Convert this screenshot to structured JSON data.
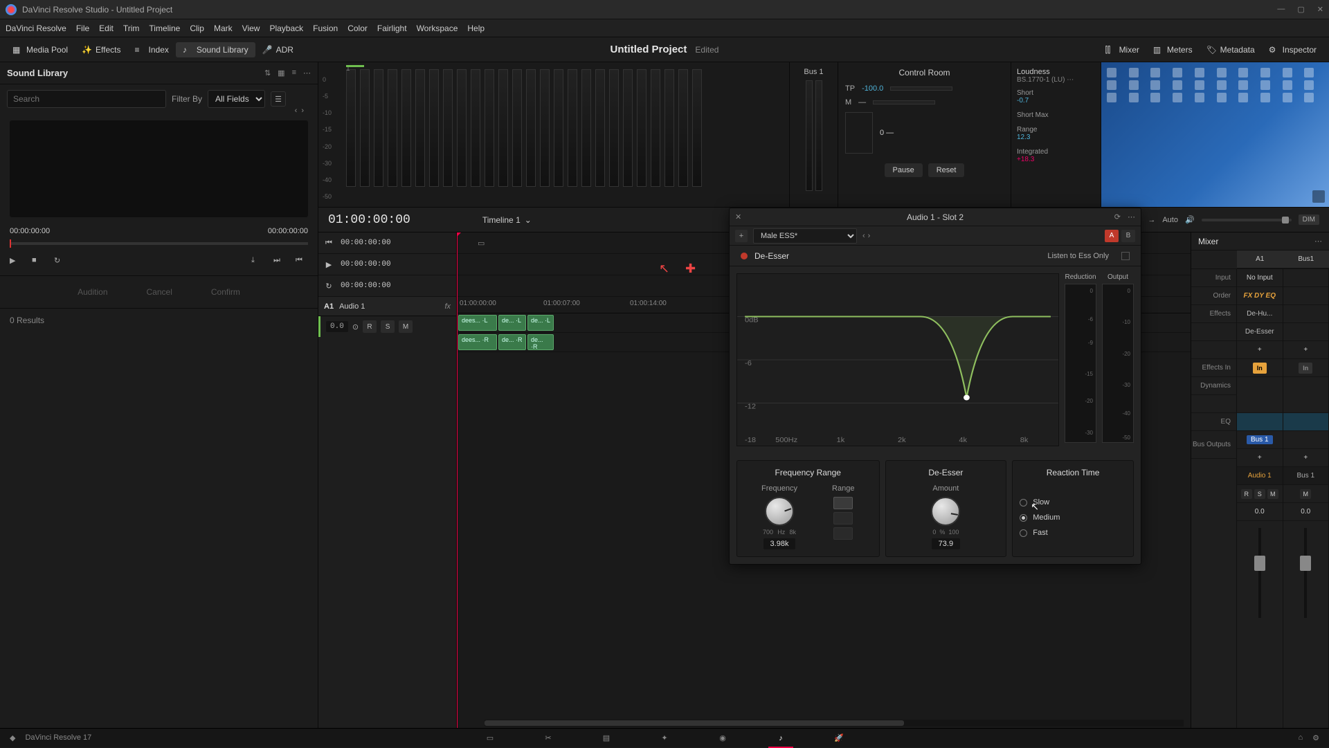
{
  "titlebar": {
    "title": "DaVinci Resolve Studio - Untitled Project"
  },
  "menu": [
    "DaVinci Resolve",
    "File",
    "Edit",
    "Trim",
    "Timeline",
    "Clip",
    "Mark",
    "View",
    "Playback",
    "Fusion",
    "Color",
    "Fairlight",
    "Workspace",
    "Help"
  ],
  "toolbar": {
    "media_pool": "Media Pool",
    "effects": "Effects",
    "index": "Index",
    "sound_library": "Sound Library",
    "adr": "ADR",
    "project": "Untitled Project",
    "status": "Edited",
    "mixer": "Mixer",
    "meters": "Meters",
    "metadata": "Metadata",
    "inspector": "Inspector"
  },
  "soundlib": {
    "title": "Sound Library",
    "search_placeholder": "Search",
    "filter_label": "Filter By",
    "filter_value": "All Fields",
    "tc_left": "00:00:00:00",
    "tc_right": "00:00:00:00",
    "audition": "Audition",
    "cancel": "Cancel",
    "confirm": "Confirm",
    "results": "0 Results"
  },
  "meters": {
    "scale": [
      "0",
      "-5",
      "-10",
      "-15",
      "-20",
      "-30",
      "-40",
      "-50"
    ],
    "bus": "Bus 1",
    "ctrl": {
      "title": "Control Room",
      "tp": "TP",
      "tp_val": "-100.0",
      "m": "M",
      "m_val": "—",
      "pause": "Pause",
      "reset": "Reset"
    },
    "loud": {
      "title": "Loudness",
      "std": "BS.1770-1 (LU)",
      "short": "Short",
      "short_v": "-0.7",
      "shortmax": "Short Max",
      "shortmax_v": "",
      "range": "Range",
      "range_v": "12.3",
      "integ": "Integrated",
      "integ_v": "+18.3"
    }
  },
  "tlheader": {
    "tc": "01:00:00:00",
    "name": "Timeline 1",
    "auto": "Auto",
    "dim": "DIM"
  },
  "transport_rows": {
    "tc1": "00:00:00:00",
    "tc2": "00:00:00:00",
    "tc3": "00:00:00:00"
  },
  "track": {
    "a1": "A1",
    "name": "Audio 1",
    "fx": "fx",
    "vol": "0.0",
    "r": "R",
    "s": "S",
    "m": "M"
  },
  "ruler": {
    "t0": "01:00:00:00",
    "t1": "01:00:07:00",
    "t2": "01:00:14:00"
  },
  "clips": {
    "c1": "dees... ·L",
    "c2": "de... ·L",
    "c3": "de... ·L",
    "c4": "dees... ·R",
    "c5": "de... ·R",
    "c6": "de... ·R"
  },
  "fx": {
    "title": "Audio 1 - Slot 2",
    "preset": "Male ESS*",
    "ab_a": "A",
    "ab_b": "B",
    "name": "De-Esser",
    "ess_label": "Listen to Ess Only",
    "reduction": "Reduction",
    "output": "Output",
    "graph_xticks": [
      "500Hz",
      "1k",
      "2k",
      "4k",
      "8k"
    ],
    "graph_yticks": [
      "0dB",
      "-6",
      "-12",
      "-18"
    ],
    "red_ticks": [
      "0",
      "-6",
      "-9",
      "-15",
      "-20",
      "-30"
    ],
    "out_ticks": [
      "0",
      "-10",
      "-20",
      "-30",
      "-40",
      "-50"
    ],
    "sec_freq": "Frequency Range",
    "sec_de": "De-Esser",
    "sec_react": "Reaction Time",
    "k_freq": "Frequency",
    "k_range": "Range",
    "k_amount": "Amount",
    "freq_lo": "700",
    "freq_unit": "Hz",
    "freq_hi": "8k",
    "freq_val": "3.98k",
    "amt_lo": "0",
    "amt_unit": "%",
    "amt_hi": "100",
    "amt_val": "73.9",
    "slow": "Slow",
    "medium": "Medium",
    "fast": "Fast"
  },
  "mixer": {
    "title": "Mixer",
    "ch_a1": "A1",
    "ch_bus": "Bus1",
    "lab_input": "Input",
    "lab_order": "Order",
    "lab_effects": "Effects",
    "lab_effin": "Effects In",
    "lab_dyn": "Dynamics",
    "lab_eq": "EQ",
    "lab_busout": "Bus Outputs",
    "noinput": "No Input",
    "order": "FX DY EQ",
    "fx1": "De-Hu...",
    "fx2": "De-Esser",
    "in": "In",
    "busout": "Bus 1",
    "chname1": "Audio 1",
    "chname2": "Bus 1",
    "r": "R",
    "s": "S",
    "m": "M",
    "vol": "0.0"
  },
  "footer": {
    "app": "DaVinci Resolve 17"
  }
}
